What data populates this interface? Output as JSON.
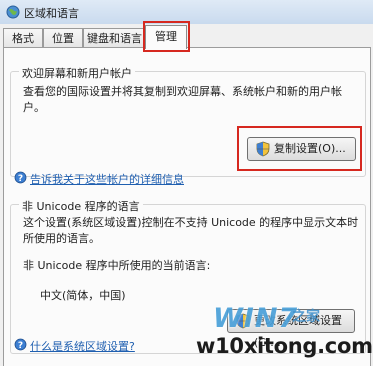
{
  "window": {
    "title": "区域和语言"
  },
  "tabs": [
    {
      "label": "格式"
    },
    {
      "label": "位置"
    },
    {
      "label": "键盘和语言"
    },
    {
      "label": "管理"
    }
  ],
  "welcome_group": {
    "title": "欢迎屏幕和新用户帐户",
    "description": "查看您的国际设置并将其复制到欢迎屏幕、系统帐户和新的用户帐户。",
    "copy_button_label": "复制设置(O)...",
    "copy_button_icon": "shield-icon",
    "help_link": "告诉我关于这些帐户的详细信息"
  },
  "unicode_group": {
    "title": "非 Unicode 程序的语言",
    "description": "这个设置(系统区域设置)控制在不支持 Unicode 的程序中显示文本时所使用的语言。",
    "current_label": "非 Unicode 程序中所使用的当前语言:",
    "current_value": "中文(简体，中国)",
    "change_button_label": "更改系统区域设置(C)...",
    "change_button_icon": "shield-icon",
    "help_link": "什么是系统区域设置?"
  },
  "watermark": {
    "logo": "WIN7",
    "logo_suffix": "之家",
    "site": "w10xitong.com"
  },
  "colors": {
    "highlight": "#d6281f",
    "link": "#1f5fb0"
  }
}
